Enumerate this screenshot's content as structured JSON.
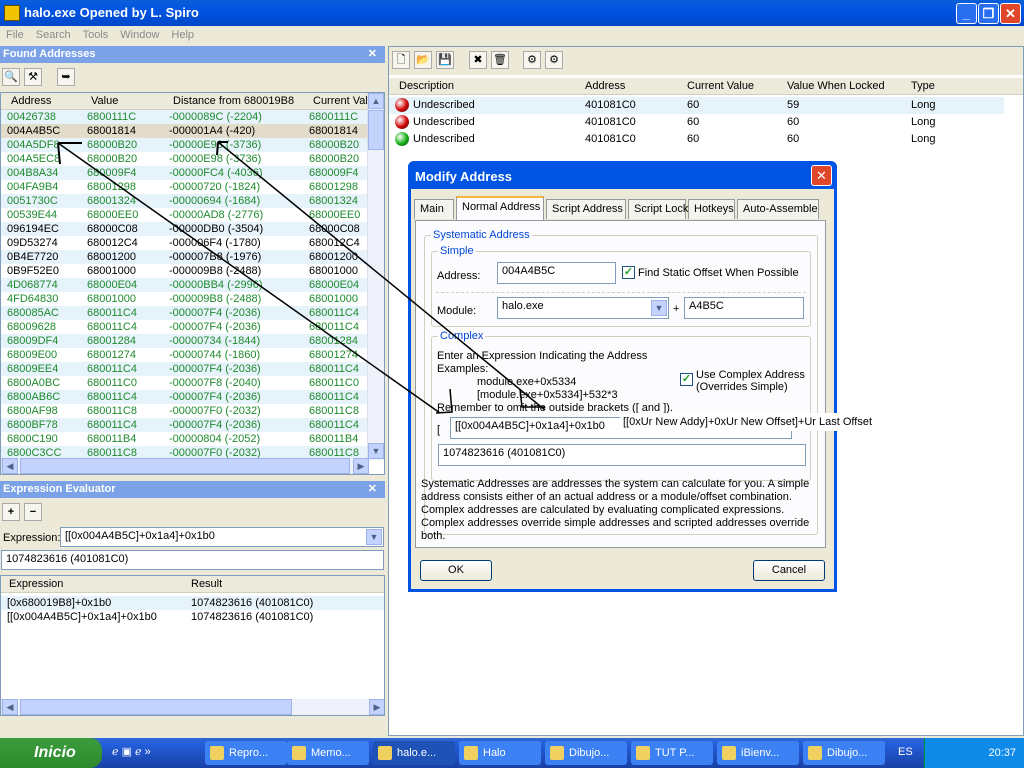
{
  "window": {
    "title": "halo.exe Opened by L. Spiro",
    "menu": [
      "File",
      "Search",
      "Tools",
      "Window",
      "Help"
    ]
  },
  "found": {
    "title": "Found Addresses",
    "columns": [
      "Address",
      "Value",
      "Distance from 680019B8",
      "Current Valu"
    ],
    "rows": [
      [
        "00426738",
        "6800111C",
        "-0000089C (-2204)",
        "6800111C",
        "g"
      ],
      [
        "004A4B5C",
        "68001814",
        "-000001A4 (-420)",
        "68001814",
        "sel"
      ],
      [
        "004A5DF8",
        "68000B20",
        "-00000E98 (-3736)",
        "68000B20",
        "g"
      ],
      [
        "004A5EC8",
        "68000B20",
        "-00000E98 (-3736)",
        "68000B20",
        "g"
      ],
      [
        "004B8A34",
        "680009F4",
        "-00000FC4 (-4036)",
        "680009F4",
        "g"
      ],
      [
        "004FA9B4",
        "68001298",
        "-00000720 (-1824)",
        "68001298",
        "g"
      ],
      [
        "0051730C",
        "68001324",
        "-00000694 (-1684)",
        "68001324",
        "g"
      ],
      [
        "00539E44",
        "68000EE0",
        "-00000AD8 (-2776)",
        "68000EE0",
        "g"
      ],
      [
        "096194EC",
        "68000C08",
        "-00000DB0 (-3504)",
        "68000C08",
        "b"
      ],
      [
        "09D53274",
        "680012C4",
        "-000006F4 (-1780)",
        "680012C4",
        "b"
      ],
      [
        "0B4E7720",
        "68001200",
        "-000007B8 (-1976)",
        "68001200",
        "b"
      ],
      [
        "0B9F52E0",
        "68001000",
        "-000009B8 (-2488)",
        "68001000",
        "b"
      ],
      [
        "4D068774",
        "68000E04",
        "-00000BB4 (-2996)",
        "68000E04",
        "g"
      ],
      [
        "4FD64830",
        "68001000",
        "-000009B8 (-2488)",
        "68001000",
        "g"
      ],
      [
        "680085AC",
        "680011C4",
        "-000007F4 (-2036)",
        "680011C4",
        "g"
      ],
      [
        "68009628",
        "680011C4",
        "-000007F4 (-2036)",
        "680011C4",
        "g"
      ],
      [
        "68009DF4",
        "68001284",
        "-00000734 (-1844)",
        "68001284",
        "g"
      ],
      [
        "68009E00",
        "68001274",
        "-00000744 (-1860)",
        "68001274",
        "g"
      ],
      [
        "68009EE4",
        "680011C4",
        "-000007F4 (-2036)",
        "680011C4",
        "g"
      ],
      [
        "6800A0BC",
        "680011C0",
        "-000007F8 (-2040)",
        "680011C0",
        "g"
      ],
      [
        "6800AB6C",
        "680011C4",
        "-000007F4 (-2036)",
        "680011C4",
        "g"
      ],
      [
        "6800AF98",
        "680011C8",
        "-000007F0 (-2032)",
        "680011C8",
        "g"
      ],
      [
        "6800BF78",
        "680011C4",
        "-000007F4 (-2036)",
        "680011C4",
        "g"
      ],
      [
        "6800C190",
        "680011B4",
        "-00000804 (-2052)",
        "680011B4",
        "g"
      ],
      [
        "6800C3CC",
        "680011C8",
        "-000007F0 (-2032)",
        "680011C8",
        "g"
      ]
    ]
  },
  "evaluator": {
    "title": "Expression Evaluator",
    "expression_label": "Expression:",
    "expression": "[[0x004A4B5C]+0x1a4]+0x1b0",
    "result": "1074823616 (401081C0)",
    "columns": [
      "Expression",
      "Result"
    ],
    "rows": [
      [
        "[0x680019B8]+0x1b0",
        "1074823616 (401081C0)"
      ],
      [
        "[[0x004A4B5C]+0x1a4]+0x1b0",
        "1074823616 (401081C0)"
      ]
    ]
  },
  "locked": {
    "columns": [
      "Description",
      "Address",
      "Current Value",
      "Value When Locked",
      "Type"
    ],
    "rows": [
      [
        "Undescribed",
        "401081C0",
        "60",
        "59",
        "Long",
        "#d00000"
      ],
      [
        "Undescribed",
        "401081C0",
        "60",
        "60",
        "Long",
        "#d00000"
      ],
      [
        "Undescribed",
        "401081C0",
        "60",
        "60",
        "Long",
        "#10b010"
      ]
    ]
  },
  "dialog": {
    "title": "Modify Address",
    "tabs": [
      "Main",
      "Normal Address",
      "Script Address",
      "Script Lock",
      "Hotkeys",
      "Auto-Assemble"
    ],
    "systematic": "Systematic Address",
    "simple": "Simple",
    "address_label": "Address:",
    "address": "004A4B5C",
    "find_static": "Find Static Offset When Possible",
    "find_static_checked": true,
    "module_label": "Module:",
    "module": "halo.exe",
    "plus": "+",
    "offset": "A4B5C",
    "complex": "Complex",
    "complex_intro": "Enter an Expression Indicating the Address",
    "examples": "Examples:",
    "ex1": "module.exe+0x5334",
    "ex2": "[module.exe+0x5334]+532*3",
    "remember": "Remember to omit the outside brackets ([ and ]).",
    "use_complex": "Use Complex Address",
    "use_complex2": "(Overrides Simple)",
    "use_complex_checked": true,
    "bracket": "[",
    "expression": "[[0x004A4B5C]+0x1a4]+0x1b0",
    "annotation": "[[0xUr New Addy]+0xUr New Offset]+Ur Last Offset",
    "result": "1074823616 (401081C0)",
    "help": "Systematic Addresses are addresses the system can calculate for you.  A simple address consists either of an actual address or a module/offset combination. Complex addresses are calculated by evaluating complicated expressions. Complex addresses override simple addresses and scripted addresses override both.",
    "ok": "OK",
    "cancel": "Cancel"
  },
  "taskbar": {
    "start": "Inicio",
    "tasks": [
      "Repro...",
      "Memo...",
      "halo.e...",
      "Halo",
      "Dibujo...",
      "TUT P...",
      "iBienv...",
      "Dibujo..."
    ],
    "lang": "ES",
    "clock": "20:37"
  }
}
